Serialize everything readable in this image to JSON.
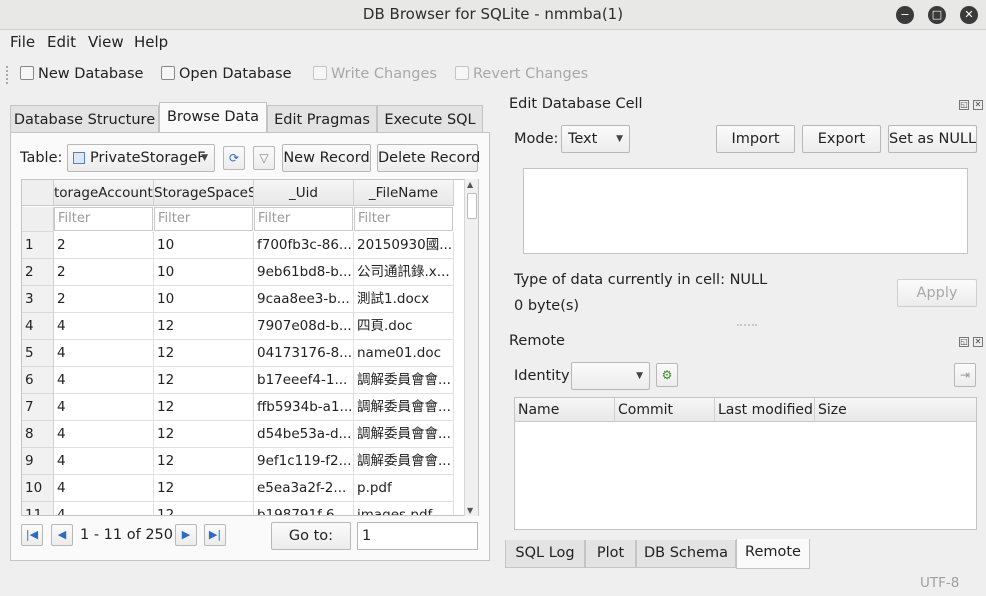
{
  "window": {
    "title": "DB Browser for SQLite - nmmba(1)"
  },
  "menu": [
    "File",
    "Edit",
    "View",
    "Help"
  ],
  "toolbar": {
    "new_database": "New Database",
    "open_database": "Open Database",
    "write_changes": "Write Changes",
    "revert_changes": "Revert Changes"
  },
  "tabs": [
    "Database Structure",
    "Browse Data",
    "Edit Pragmas",
    "Execute SQL"
  ],
  "browse": {
    "table_label": "Table:",
    "table_value": "PrivateStorageF",
    "new_record": "New Record",
    "delete_record": "Delete Record",
    "columns": [
      "torageAccountS",
      "StorageSpaceS",
      "_Uid",
      "_FileName"
    ],
    "filter_placeholder": "Filter",
    "rows": [
      [
        "1",
        "2",
        "10",
        "f700fb3c-86...",
        "20150930國..."
      ],
      [
        "2",
        "2",
        "10",
        "9eb61bd8-b...",
        "公司通訊錄.x..."
      ],
      [
        "3",
        "2",
        "10",
        "9caa8ee3-b...",
        "測試1.docx"
      ],
      [
        "4",
        "4",
        "12",
        "7907e08d-b...",
        "四頁.doc"
      ],
      [
        "5",
        "4",
        "12",
        "04173176-8...",
        "name01.doc"
      ],
      [
        "6",
        "4",
        "12",
        "b17eeef4-1...",
        "調解委員會會..."
      ],
      [
        "7",
        "4",
        "12",
        "ffb5934b-a1...",
        "調解委員會會..."
      ],
      [
        "8",
        "4",
        "12",
        "d54be53a-d...",
        "調解委員會會..."
      ],
      [
        "9",
        "4",
        "12",
        "9ef1c119-f2...",
        "調解委員會會..."
      ],
      [
        "10",
        "4",
        "12",
        "e5ea3a2f-2...",
        "p.pdf"
      ],
      [
        "11",
        "4",
        "12",
        "b198791f-6...",
        "images.pdf"
      ]
    ],
    "page_info": "1 - 11 of 250",
    "goto_label": "Go to:",
    "goto_value": "1"
  },
  "edit_cell": {
    "title": "Edit Database Cell",
    "mode_label": "Mode:",
    "mode_value": "Text",
    "import": "Import",
    "export": "Export",
    "set_null": "Set as NULL",
    "type_info": "Type of data currently in cell: NULL",
    "size_info": "0 byte(s)",
    "apply": "Apply"
  },
  "remote": {
    "title": "Remote",
    "identity_label": "Identity",
    "columns": [
      "Name",
      "Commit",
      "Last modified",
      "Size"
    ]
  },
  "bottom_tabs": [
    "SQL Log",
    "Plot",
    "DB Schema",
    "Remote"
  ],
  "status": {
    "encoding": "UTF-8"
  }
}
